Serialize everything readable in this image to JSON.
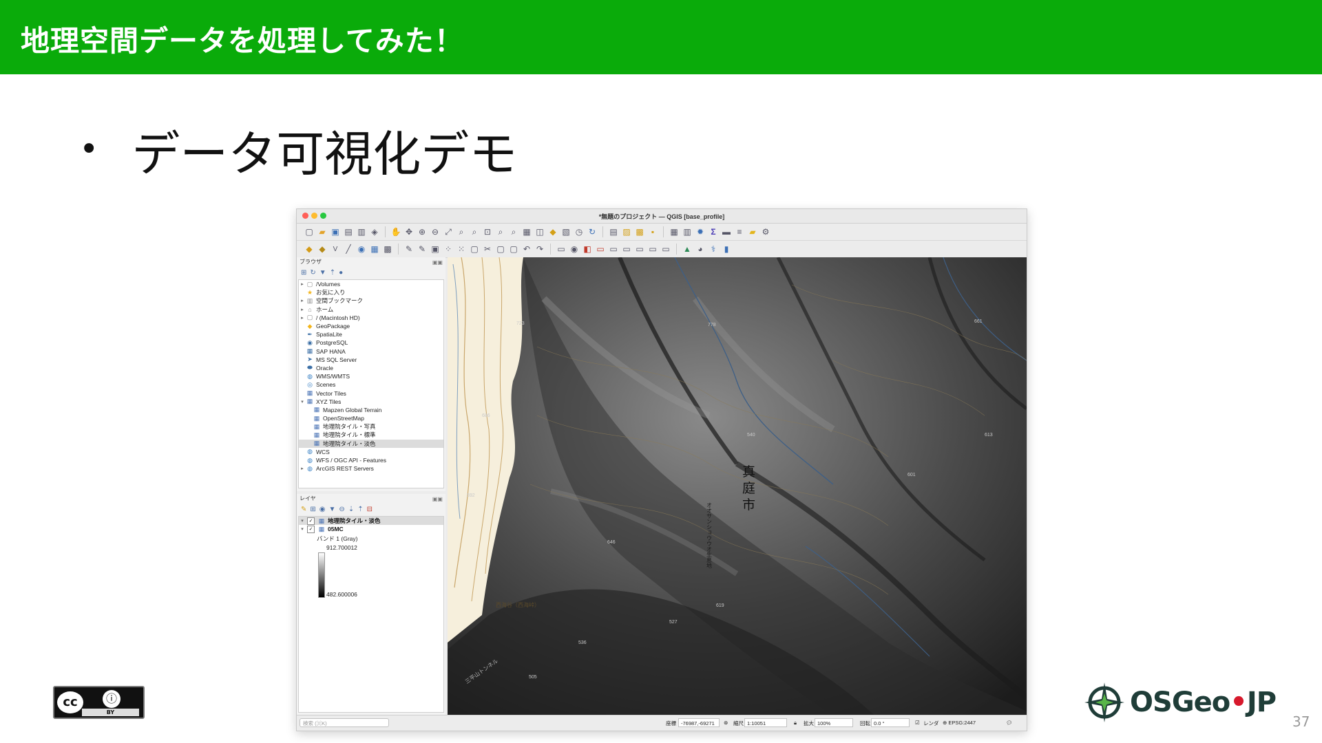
{
  "slide": {
    "title": "地理空間データを処理してみた！",
    "bullet": "データ可視化デモ",
    "page_number": "37",
    "license_badge": "BY",
    "footer_logo": {
      "prefix": "OSGeo",
      "dot": "•",
      "suffix": "JP"
    }
  },
  "window": {
    "title": "*無題のプロジェクト — QGIS [base_profile]"
  },
  "browser_panel": {
    "title": "ブラウザ",
    "items": [
      {
        "label": "/Volumes",
        "icon": "folder-icon",
        "arrow": "▸"
      },
      {
        "label": "お気に入り",
        "icon": "star-icon",
        "arrow": ""
      },
      {
        "label": "空間ブックマーク",
        "icon": "bookmark-icon",
        "arrow": "▸"
      },
      {
        "label": "ホーム",
        "icon": "home-icon",
        "arrow": "▸"
      },
      {
        "label": "/ (Macintosh HD)",
        "icon": "folder-icon",
        "arrow": "▸"
      },
      {
        "label": "GeoPackage",
        "icon": "geopackage-icon",
        "arrow": ""
      },
      {
        "label": "SpatiaLite",
        "icon": "spatialite-icon",
        "arrow": ""
      },
      {
        "label": "PostgreSQL",
        "icon": "postgresql-icon",
        "arrow": ""
      },
      {
        "label": "SAP HANA",
        "icon": "sap-hana-icon",
        "arrow": ""
      },
      {
        "label": "MS SQL Server",
        "icon": "mssql-icon",
        "arrow": ""
      },
      {
        "label": "Oracle",
        "icon": "oracle-icon",
        "arrow": ""
      },
      {
        "label": "WMS/WMTS",
        "icon": "wms-icon",
        "arrow": ""
      },
      {
        "label": "Scenes",
        "icon": "scenes-icon",
        "arrow": ""
      },
      {
        "label": "Vector Tiles",
        "icon": "vector-tiles-icon",
        "arrow": ""
      },
      {
        "label": "XYZ Tiles",
        "icon": "xyz-tiles-icon",
        "arrow": "▾"
      },
      {
        "label": "Mapzen Global Terrain",
        "icon": "xyz-tiles-icon",
        "arrow": "",
        "indent": true
      },
      {
        "label": "OpenStreetMap",
        "icon": "xyz-tiles-icon",
        "arrow": "",
        "indent": true
      },
      {
        "label": "地理院タイル・写真",
        "icon": "xyz-tiles-icon",
        "arrow": "",
        "indent": true
      },
      {
        "label": "地理院タイル・標準",
        "icon": "xyz-tiles-icon",
        "arrow": "",
        "indent": true
      },
      {
        "label": "地理院タイル・淡色",
        "icon": "xyz-tiles-icon",
        "arrow": "",
        "indent": true,
        "selected": true
      },
      {
        "label": "WCS",
        "icon": "wcs-icon",
        "arrow": ""
      },
      {
        "label": "WFS / OGC API - Features",
        "icon": "wfs-icon",
        "arrow": ""
      },
      {
        "label": "ArcGIS REST Servers",
        "icon": "arcgis-icon",
        "arrow": "▸"
      }
    ]
  },
  "layers_panel": {
    "title": "レイヤ",
    "layers": [
      {
        "name": "地理院タイル・淡色",
        "checked": true
      },
      {
        "name": "05MC",
        "checked": true
      }
    ],
    "band": "バンド 1 (Gray)",
    "max_value": "912.700012",
    "min_value": "482.600006"
  },
  "map_labels": {
    "city_chars": [
      "真",
      "庭",
      "市"
    ],
    "elevations": [
      "723",
      "778",
      "661",
      "686",
      "601",
      "540",
      "592",
      "646",
      "527",
      "505",
      "536",
      "619",
      "613"
    ],
    "place": "西海谷（西海峠）",
    "mountain": "三平山トンネル",
    "vertical_place": "オオサンショウウオ生息地"
  },
  "status_bar": {
    "search_placeholder": "検索 (⌘K)",
    "coord_label": "座標",
    "coord_value": "-76987,-69271",
    "scale_label": "縮尺",
    "scale_value": "1:10051",
    "magnifier_label": "拡大",
    "magnifier_value": "100%",
    "rotation_label": "回転",
    "rotation_value": "0.0 °",
    "render_label": "レンダ",
    "crs": "EPSG:2447"
  },
  "colors": {
    "header": "#0aab0a",
    "osgeo_dot": "#d7192c"
  }
}
